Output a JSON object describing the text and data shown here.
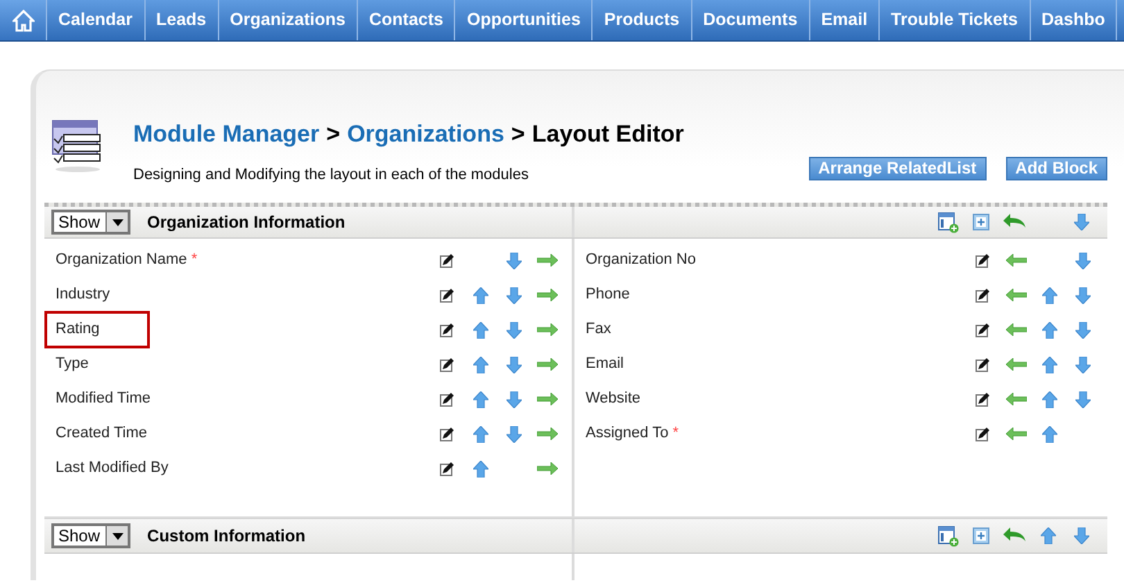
{
  "nav": {
    "items": [
      {
        "label": "Calendar"
      },
      {
        "label": "Leads"
      },
      {
        "label": "Organizations"
      },
      {
        "label": "Contacts"
      },
      {
        "label": "Opportunities"
      },
      {
        "label": "Products"
      },
      {
        "label": "Documents"
      },
      {
        "label": "Email"
      },
      {
        "label": "Trouble Tickets"
      },
      {
        "label": "Dashbo"
      }
    ]
  },
  "header": {
    "breadcrumb": [
      {
        "label": "Module Manager",
        "kind": "link"
      },
      {
        "label": ">",
        "kind": "separator"
      },
      {
        "label": "Organizations",
        "kind": "link"
      },
      {
        "label": ">",
        "kind": "separator"
      },
      {
        "label": "Layout Editor",
        "kind": "current"
      }
    ],
    "description": "Designing and Modifying the layout in each of the modules",
    "buttons": [
      {
        "label": "Arrange RelatedList"
      },
      {
        "label": "Add Block"
      }
    ]
  },
  "blocks": [
    {
      "visibility": "Show",
      "title": "Organization Information",
      "can_move_up": false,
      "can_move_down": true,
      "left_fields": [
        {
          "label": "Organization Name",
          "required_mark": "*",
          "highlighted": false,
          "can_move_up": false,
          "can_move_down": true
        },
        {
          "label": "Industry",
          "highlighted": false,
          "can_move_up": true,
          "can_move_down": true
        },
        {
          "label": "Rating",
          "highlighted": true,
          "can_move_up": true,
          "can_move_down": true
        },
        {
          "label": "Type",
          "highlighted": false,
          "can_move_up": true,
          "can_move_down": true
        },
        {
          "label": "Modified Time",
          "highlighted": false,
          "can_move_up": true,
          "can_move_down": true
        },
        {
          "label": "Created Time",
          "highlighted": false,
          "can_move_up": true,
          "can_move_down": true
        },
        {
          "label": "Last Modified By",
          "highlighted": false,
          "can_move_up": true,
          "can_move_down": false
        }
      ],
      "right_fields": [
        {
          "label": "Organization No",
          "highlighted": false,
          "can_move_up": false,
          "can_move_down": true
        },
        {
          "label": "Phone",
          "highlighted": false,
          "can_move_up": true,
          "can_move_down": true
        },
        {
          "label": "Fax",
          "highlighted": false,
          "can_move_up": true,
          "can_move_down": true
        },
        {
          "label": "Email",
          "highlighted": false,
          "can_move_up": true,
          "can_move_down": true
        },
        {
          "label": "Website",
          "highlighted": false,
          "can_move_up": true,
          "can_move_down": true
        },
        {
          "label": "Assigned To",
          "required_mark": "*",
          "highlighted": false,
          "can_move_up": true,
          "can_move_down": false
        }
      ]
    },
    {
      "visibility": "Show",
      "title": "Custom Information",
      "can_move_up": true,
      "can_move_down": true
    }
  ]
}
